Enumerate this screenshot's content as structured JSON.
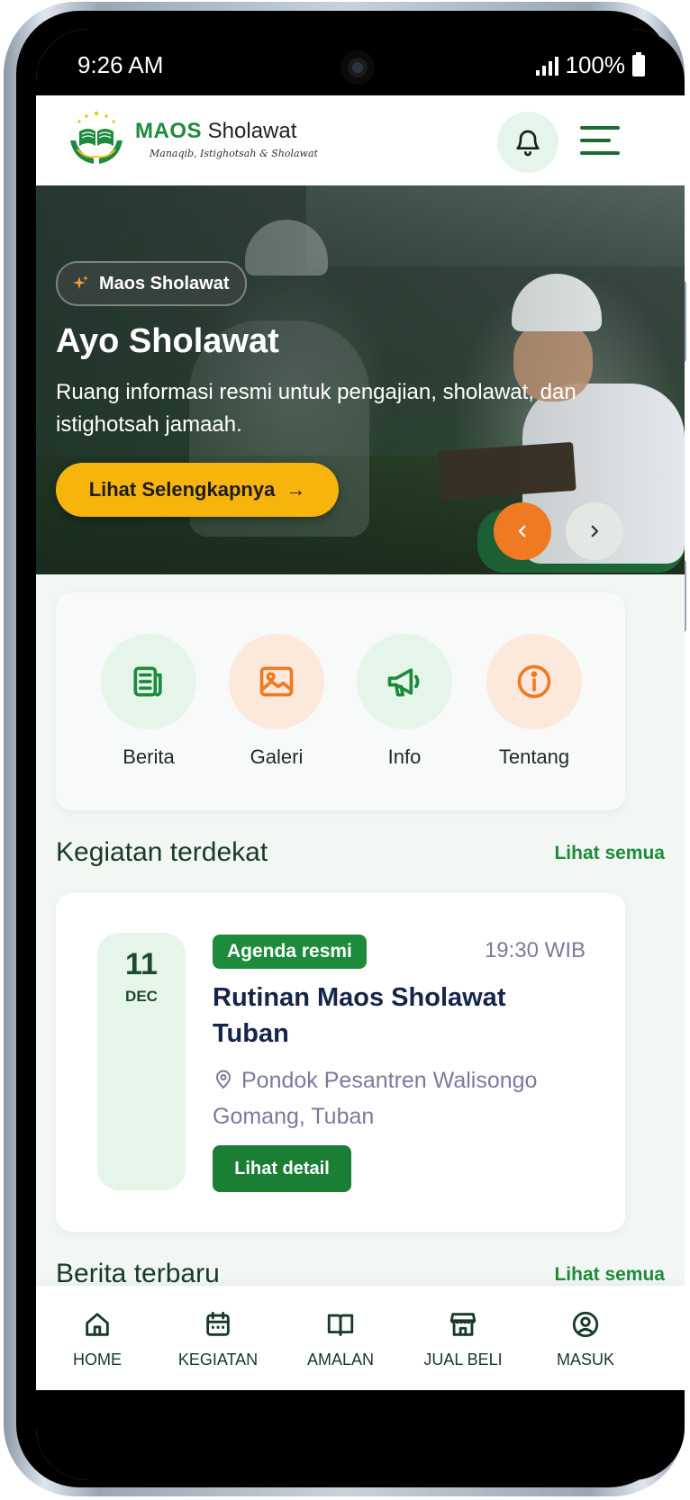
{
  "status_bar": {
    "time": "9:26 AM",
    "battery": "100%"
  },
  "header": {
    "brand_bold": "MAOS",
    "brand_regular": "Sholawat",
    "tagline": "Manaqib, Istighotsah & Sholawat",
    "icons": [
      "logo-icon",
      "bell-icon",
      "menu-icon"
    ]
  },
  "hero": {
    "badge": "Maos Sholawat",
    "title": "Ayo Sholawat",
    "subtitle": "Ruang informasi resmi untuk pengajian, sholawat, dan istighotsah jamaah.",
    "cta": "Lihat Selengkapnya",
    "cta_arrow": "→",
    "prev": "‹",
    "next": "›"
  },
  "quick_links": [
    {
      "label": "Berita",
      "icon": "news-icon",
      "color": "#1e8a3c",
      "bg": "#e6f5ea"
    },
    {
      "label": "Galeri",
      "icon": "image-icon",
      "color": "#ef7a22",
      "bg": "#fde9dc"
    },
    {
      "label": "Info",
      "icon": "megaphone-icon",
      "color": "#1e8a3c",
      "bg": "#e6f5ea"
    },
    {
      "label": "Tentang",
      "icon": "info-icon",
      "color": "#ef7a22",
      "bg": "#fde9dc"
    }
  ],
  "upcoming": {
    "title": "Kegiatan terdekat",
    "see_all": "Lihat semua",
    "event": {
      "day": "11",
      "month": "DEC",
      "tag": "Agenda resmi",
      "time": "19:30 WIB",
      "title": "Rutinan Maos Sholawat Tuban",
      "location": "Pondok Pesantren Walisongo Gomang, Tuban",
      "button": "Lihat detail"
    }
  },
  "news": {
    "title": "Berita terbaru",
    "see_all": "Lihat semua"
  },
  "bottom_nav": [
    {
      "label": "HOME",
      "icon": "home-icon"
    },
    {
      "label": "KEGIATAN",
      "icon": "calendar-icon"
    },
    {
      "label": "AMALAN",
      "icon": "book-icon"
    },
    {
      "label": "JUAL BELI",
      "icon": "store-icon"
    },
    {
      "label": "MASUK",
      "icon": "user-icon"
    }
  ],
  "colors": {
    "primary": "#1e8a3c",
    "accent": "#f7b40c",
    "orange": "#ef7a22",
    "dark_text": "#163a25"
  }
}
